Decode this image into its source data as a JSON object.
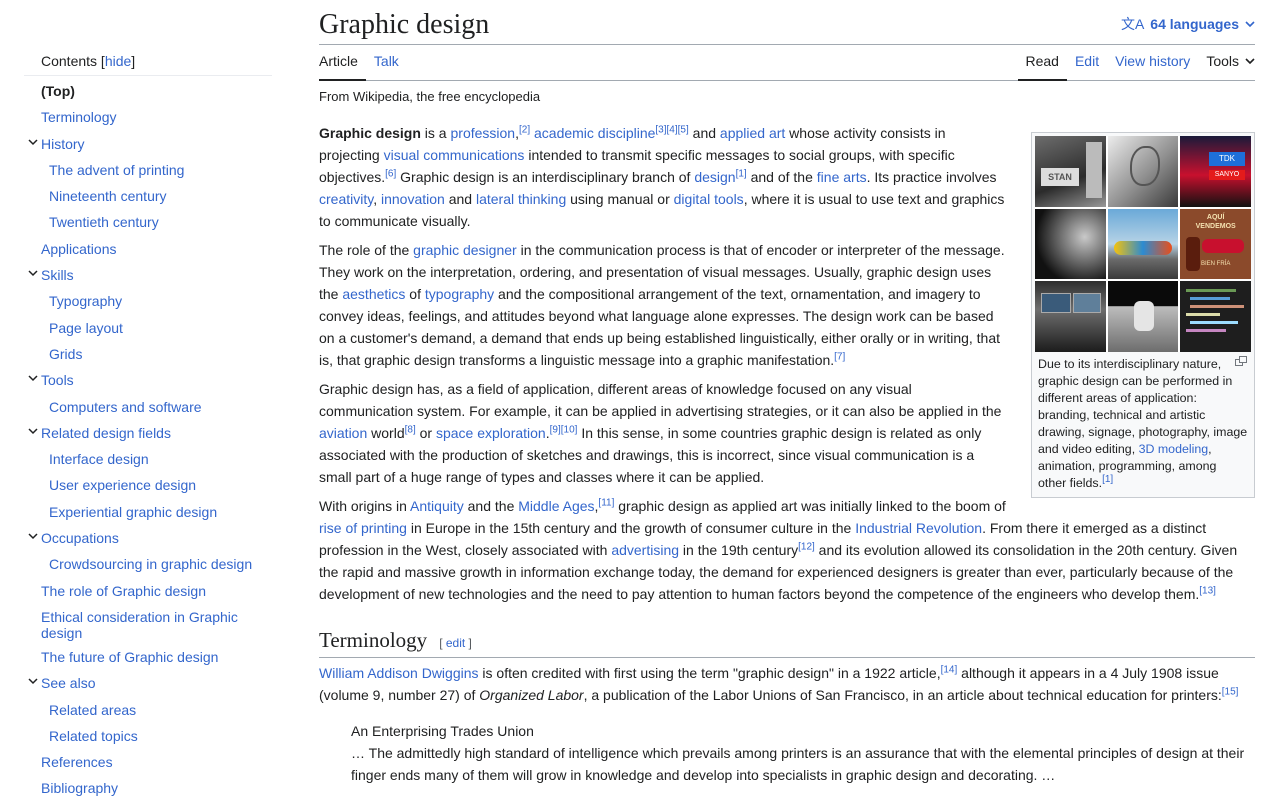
{
  "toc": {
    "header": "Contents",
    "hide_label": "hide",
    "items": [
      {
        "label": "(Top)",
        "level": 0,
        "type": "top"
      },
      {
        "label": "Terminology",
        "level": 1
      },
      {
        "label": "History",
        "level": 1,
        "expandable": true
      },
      {
        "label": "The advent of printing",
        "level": 2
      },
      {
        "label": "Nineteenth century",
        "level": 2
      },
      {
        "label": "Twentieth century",
        "level": 2
      },
      {
        "label": "Applications",
        "level": 1
      },
      {
        "label": "Skills",
        "level": 1,
        "expandable": true
      },
      {
        "label": "Typography",
        "level": 2
      },
      {
        "label": "Page layout",
        "level": 2
      },
      {
        "label": "Grids",
        "level": 2
      },
      {
        "label": "Tools",
        "level": 1,
        "expandable": true
      },
      {
        "label": "Computers and software",
        "level": 2
      },
      {
        "label": "Related design fields",
        "level": 1,
        "expandable": true
      },
      {
        "label": "Interface design",
        "level": 2
      },
      {
        "label": "User experience design",
        "level": 2
      },
      {
        "label": "Experiential graphic design",
        "level": 2
      },
      {
        "label": "Occupations",
        "level": 1,
        "expandable": true
      },
      {
        "label": "Crowdsourcing in graphic design",
        "level": 2
      },
      {
        "label": "The role of Graphic design",
        "level": 1
      },
      {
        "label": "Ethical consideration in Graphic design",
        "level": 1
      },
      {
        "label": "The future of Graphic design",
        "level": 1
      },
      {
        "label": "See also",
        "level": 1,
        "expandable": true
      },
      {
        "label": "Related areas",
        "level": 2
      },
      {
        "label": "Related topics",
        "level": 2
      },
      {
        "label": "References",
        "level": 1
      },
      {
        "label": "Bibliography",
        "level": 1
      }
    ]
  },
  "page": {
    "title": "Graphic design",
    "languages_label": "64 languages",
    "lang_icon": "文A",
    "tabs_left": [
      "Article",
      "Talk"
    ],
    "tabs_right": [
      "Read",
      "Edit",
      "View history",
      "Tools"
    ],
    "tagline": "From Wikipedia, the free encyclopedia"
  },
  "infobox": {
    "caption_before": "Due to its interdisciplinary nature, graphic design can be performed in different areas of application: branding, technical and artistic drawing, signage, photography, image and video editing, ",
    "caption_link": "3D modeling",
    "caption_after": ", animation, programming, among other fields.",
    "caption_ref": "[1]",
    "collage_labels": {
      "stan": "STAN",
      "tdk": "TDK",
      "sanyo": "SANYO",
      "aqui": "AQUÍ",
      "vendemos": "VENDEMOS",
      "bien": "BIEN FRÍA"
    }
  },
  "section": {
    "heading": "Terminology",
    "edit_open": "[ ",
    "edit_label": "edit",
    "edit_close": " ]"
  },
  "quote": {
    "title": "An Enterprising Trades Union",
    "text": "… The admittedly high standard of intelligence which prevails among printers is an assurance that with the elemental principles of design at their finger ends many of them will grow in knowledge and develop into specialists in graphic design and decorating. …"
  },
  "colors": {
    "link": "#3366cc",
    "text": "#202122",
    "rule": "#a2a9b1"
  }
}
